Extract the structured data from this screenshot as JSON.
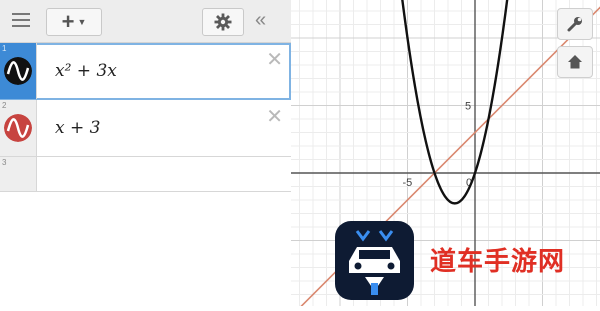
{
  "rows": [
    {
      "index": "1",
      "expression": "x² + 3x",
      "color": "#111111",
      "active": true
    },
    {
      "index": "2",
      "expression": "x + 3",
      "color": "#c74440",
      "active": false
    },
    {
      "index": "3",
      "expression": "",
      "color": "",
      "active": false
    }
  ],
  "axis": {
    "x_labels": [
      "-5",
      "0"
    ],
    "y_labels": [
      "5"
    ]
  },
  "functions": {
    "parabola": {
      "expression": "x^2+3x",
      "color": "#111111"
    },
    "line": {
      "expression": "x+3",
      "color": "#d9876f"
    }
  },
  "watermark": {
    "text": "道车手游网"
  }
}
